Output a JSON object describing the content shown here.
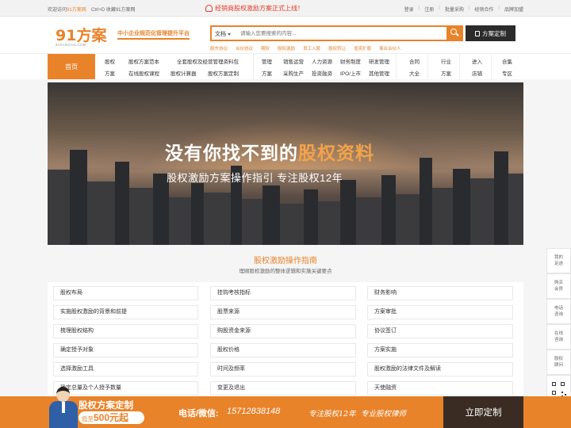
{
  "topbar": {
    "welcome_prefix": "欢迎访问",
    "site_name": "91方案网",
    "shortcut": "Ctrl+D 收藏91方案网",
    "announcement": "经销商股权激励方案正式上线！",
    "links": [
      "登录",
      "注册",
      "批量采购",
      "经销合作",
      "品牌加盟"
    ]
  },
  "header": {
    "logo_text": "91方案",
    "logo_sub": "91FANGAN.COM",
    "slogan": "中小企业规范化管理提升平台",
    "search": {
      "type": "文档",
      "placeholder": "请输入您要搜索的内容...",
      "icon": "search-icon"
    },
    "custom_button": "方案定制",
    "hot_links": [
      "股东协议",
      "合伙协议",
      "期权",
      "股权激励",
      "员工入股",
      "股权转让",
      "增资扩股",
      "事业合伙人"
    ]
  },
  "nav": {
    "home": "首页",
    "groups": [
      {
        "title": [
          "股权",
          "方案"
        ],
        "items": [
          "股权方案范本",
          "全套股权及经营管理资料包",
          "在线股权课程",
          "股权计算器",
          "股权方案定制"
        ]
      },
      {
        "title": [
          "管理",
          "方案"
        ],
        "items": [
          "销售运营",
          "人力资源",
          "财务制度",
          "研发管理",
          "采购生产",
          "投资融资",
          "IPO/上市",
          "其他管理"
        ]
      },
      {
        "title": [
          "合同",
          "大全"
        ],
        "items": []
      },
      {
        "title": [
          "行业",
          "方案"
        ],
        "items": []
      },
      {
        "title": [
          "进入",
          "店铺"
        ],
        "items": []
      },
      {
        "title": [
          "合集",
          "专区"
        ],
        "items": []
      }
    ]
  },
  "banner": {
    "headline_prefix": "没有你找不到的",
    "headline_highlight": "股权资料",
    "subline": "股权激励方案操作指引 专注股权12年"
  },
  "guide": {
    "title": "股权激励操作指南",
    "subtitle": "理顺股权激励的整体逻辑和实施关键要点",
    "columns": [
      [
        "股权布局",
        "实施股权激励的背景和前提",
        "梳理股权结构",
        "确定授予对象",
        "选择激励工具",
        "确定总量及个人授予数量"
      ],
      [
        "挂钩考核指标",
        "股票来源",
        "购股资金来源",
        "股权价格",
        "时间及频率",
        "变更及退出"
      ],
      [
        "财务影响",
        "方案审批",
        "协议签订",
        "方案实施",
        "股权激励的法律文件及解读",
        "天使融资"
      ]
    ]
  },
  "sidebar": {
    "items": [
      [
        "我的",
        "足迹"
      ],
      [
        "购买",
        "会员"
      ],
      [
        "电话",
        "咨询"
      ],
      [
        "在线",
        "咨询"
      ],
      [
        "股权",
        "顾问"
      ]
    ],
    "qr_icon": "qr-code-icon",
    "top_icon": "back-to-top-icon"
  },
  "footer": {
    "title": "股权方案定制",
    "price_prefix": "低至",
    "price": "500元起",
    "phone_label": "电话/微信:",
    "phone": "15712838148",
    "tag1": "专注股权12年",
    "tag2": "专业股权律师",
    "cta": "立即定制"
  }
}
